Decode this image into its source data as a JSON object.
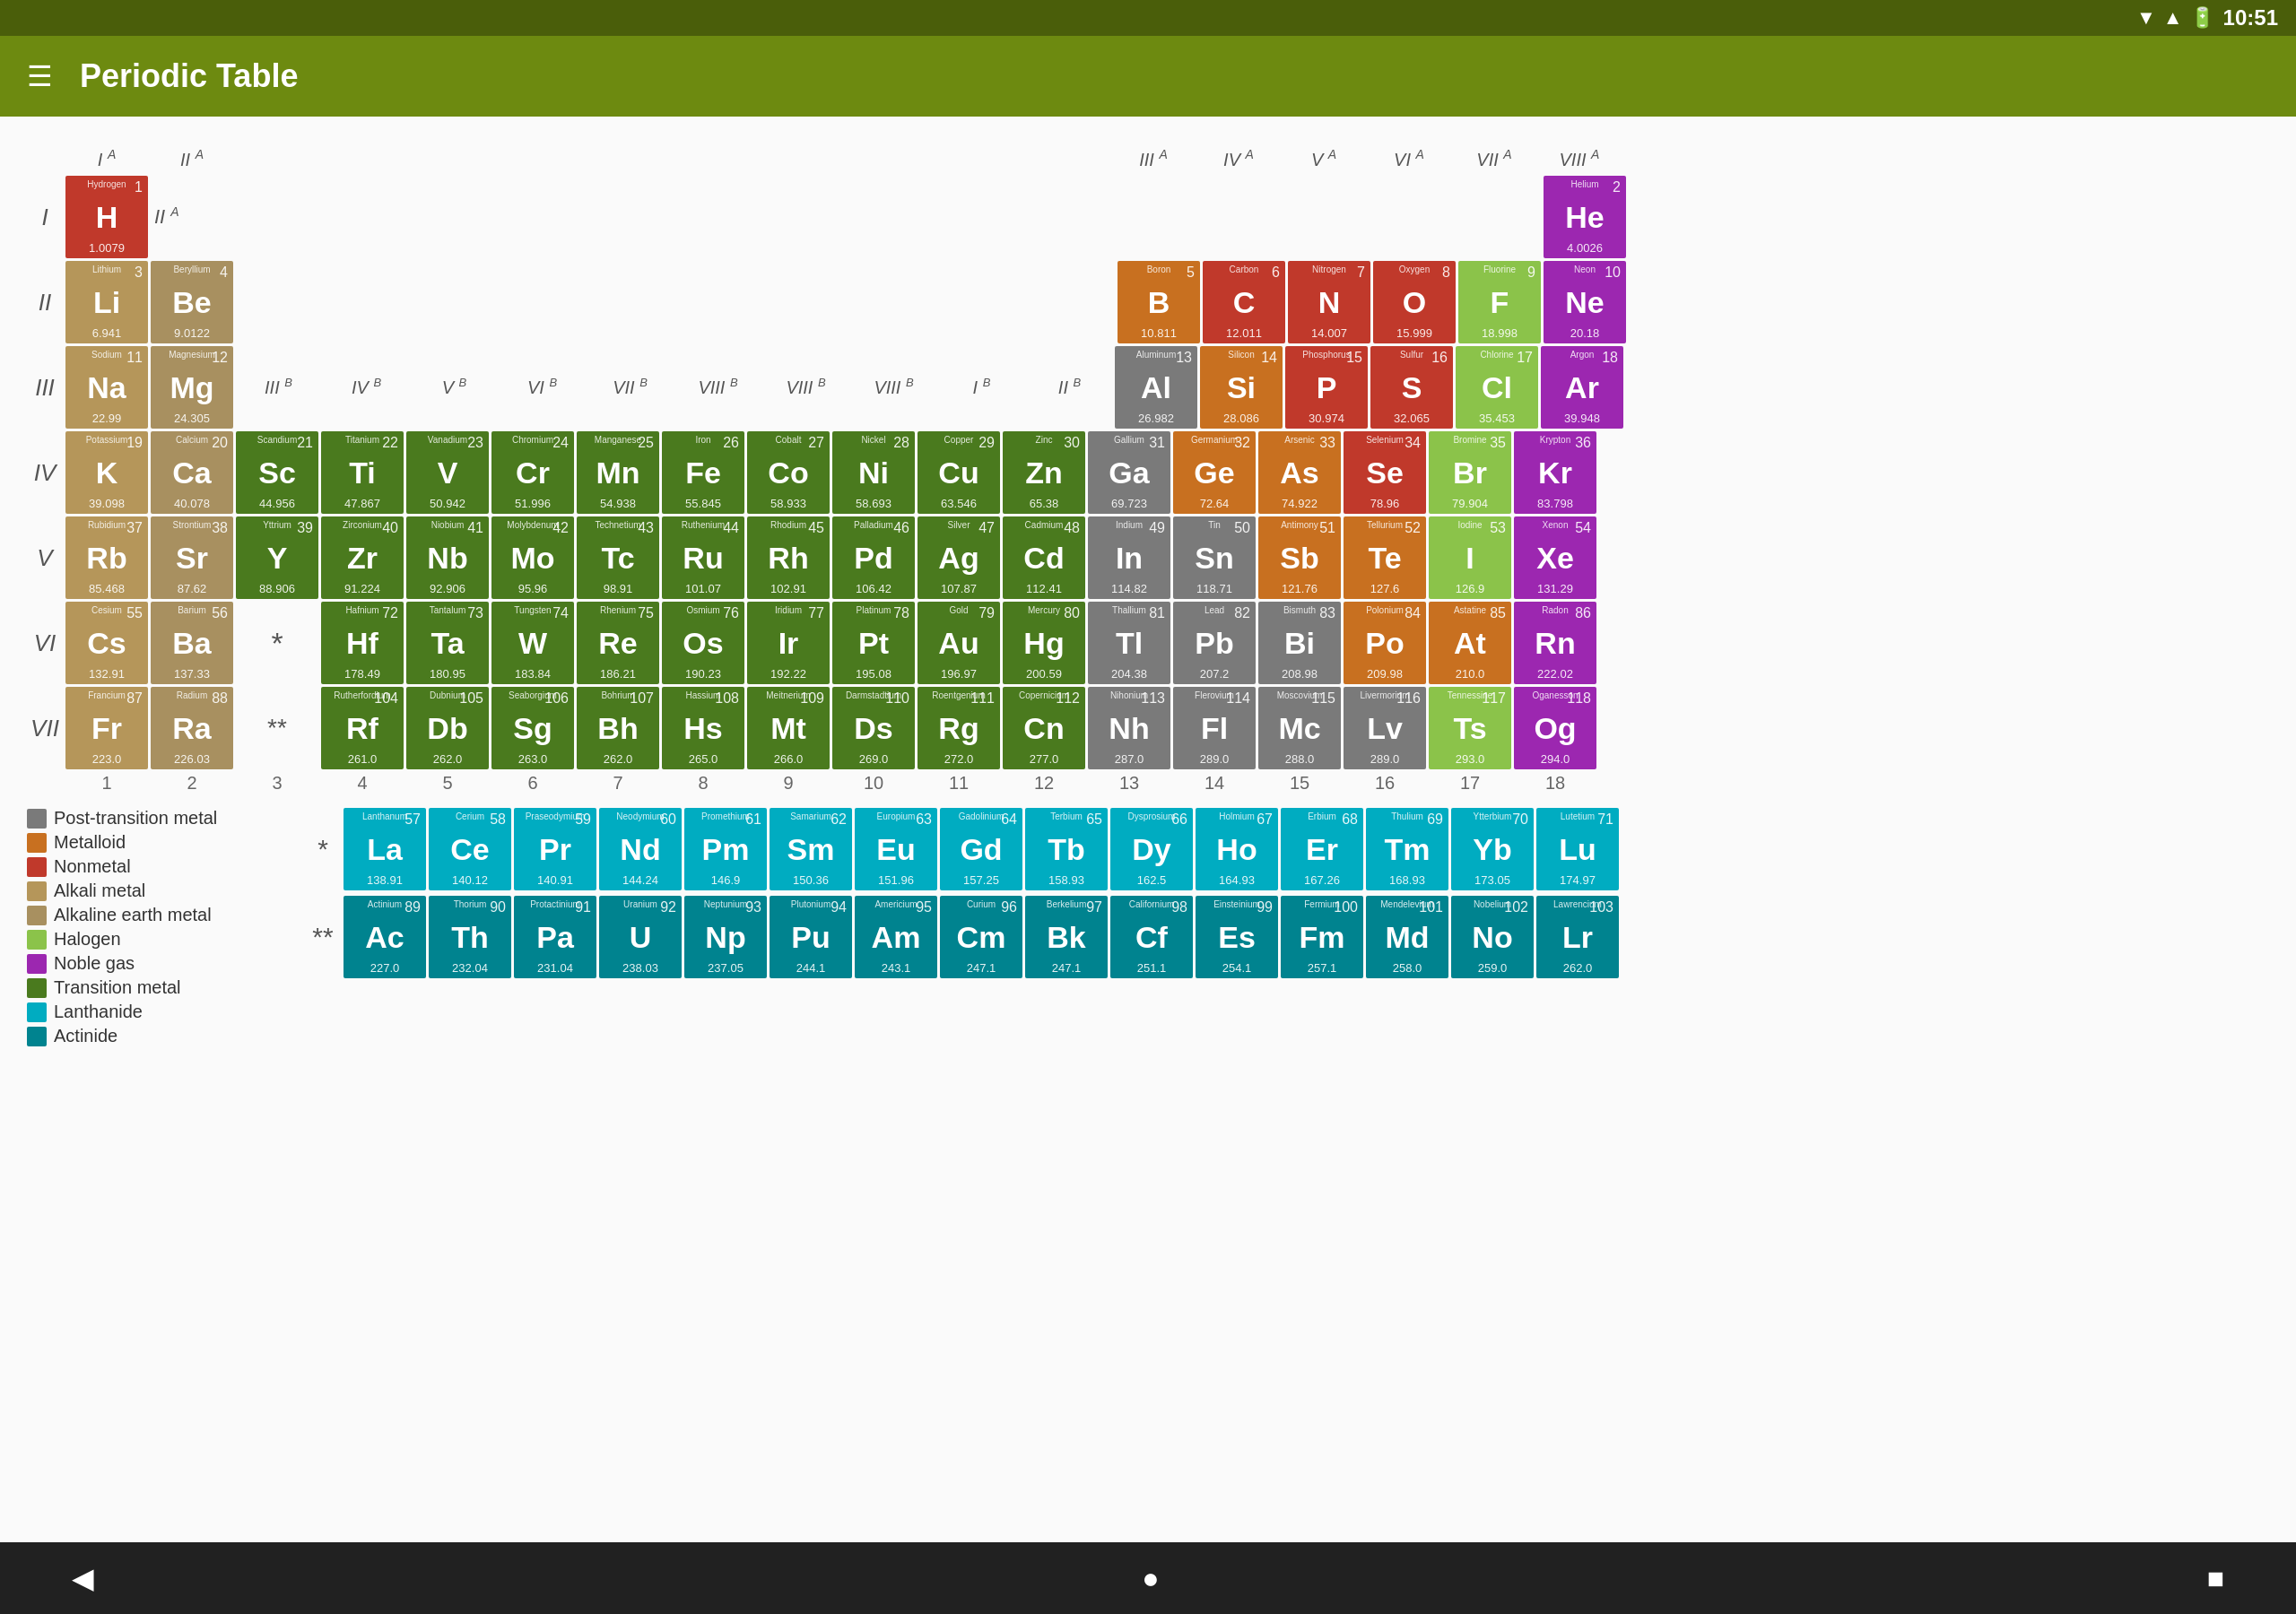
{
  "statusBar": {
    "time": "10:51",
    "icons": [
      "wifi",
      "signal",
      "battery"
    ]
  },
  "appBar": {
    "title": "Periodic Table",
    "menuIcon": "☰"
  },
  "legend": [
    {
      "key": "post-transition",
      "label": "Post-transition metal",
      "color": "#7a7a7a"
    },
    {
      "key": "metalloid",
      "label": "Metalloid",
      "color": "#c87020"
    },
    {
      "key": "nonmetal",
      "label": "Nonmetal",
      "color": "#c0392b"
    },
    {
      "key": "alkali",
      "label": "Alkali metal",
      "color": "#b5965a"
    },
    {
      "key": "alkaline",
      "label": "Alkaline earth metal",
      "color": "#a89060"
    },
    {
      "key": "halogen",
      "label": "Halogen",
      "color": "#8bc34a"
    },
    {
      "key": "noble",
      "label": "Noble gas",
      "color": "#9c27b0"
    },
    {
      "key": "transition",
      "label": "Transition metal",
      "color": "#4a7a1e"
    },
    {
      "key": "lanthanide",
      "label": "Lanthanide",
      "color": "#00acc1"
    },
    {
      "key": "actinide",
      "label": "Actinide",
      "color": "#00838f"
    }
  ],
  "rows": {
    "IA": "I A",
    "IIA": "II A",
    "IIIA": "III A",
    "IVA": "IV A",
    "VA": "V A",
    "VIA": "VI A",
    "VIIA": "VII A",
    "VIIIA": "VIII A",
    "IIIB": "III B",
    "IVB": "IV B",
    "VB": "V B",
    "VIB": "VI B",
    "VIIB": "VII B",
    "VIIIB1": "VIII B",
    "VIIIB2": "VIII B",
    "VIIIB3": "VIII B",
    "IB": "I B",
    "IIB": "II B"
  },
  "periods": [
    "I",
    "II",
    "III",
    "IV",
    "V",
    "VI",
    "VII"
  ],
  "groups": [
    "1",
    "2",
    "3",
    "4",
    "5",
    "6",
    "7",
    "8",
    "9",
    "10",
    "11",
    "12",
    "13",
    "14",
    "15",
    "16",
    "17",
    "18"
  ]
}
